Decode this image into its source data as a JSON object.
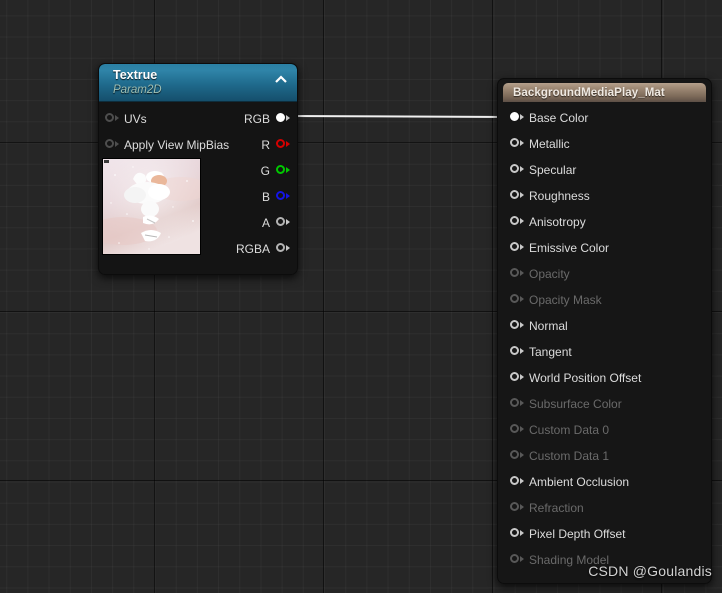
{
  "app": {
    "editor": "Material Graph",
    "watermark": "CSDN @Goulandis"
  },
  "canvas": {
    "background_color": "#262626",
    "grid_minor_color": "#2d2d2d",
    "grid_major_color": "#000000"
  },
  "texture_node": {
    "title": "Textrue",
    "subtitle": "Param2D",
    "header_color": "#2a7fa3",
    "collapse_icon": "chevron-up-icon",
    "inputs": [
      {
        "label": "UVs",
        "state": "unconnected",
        "color": "#4e4e4e"
      },
      {
        "label": "Apply View MipBias",
        "state": "unconnected",
        "color": "#4e4e4e"
      }
    ],
    "outputs": [
      {
        "label": "RGB",
        "state": "connected",
        "color": "#ffffff"
      },
      {
        "label": "R",
        "state": "unconnected",
        "color": "#d40000"
      },
      {
        "label": "G",
        "state": "unconnected",
        "color": "#00c800"
      },
      {
        "label": "B",
        "state": "unconnected",
        "color": "#1414e6"
      },
      {
        "label": "A",
        "state": "unconnected",
        "color": "#b4b4b4"
      },
      {
        "label": "RGBA",
        "state": "unconnected",
        "color": "#b4b4b4"
      }
    ],
    "thumbnail": {
      "description": "pink sky with white clouds texture preview"
    }
  },
  "material_node": {
    "title": "BackgroundMediaPlay_Mat",
    "header_color": "#a08b76",
    "inputs": [
      {
        "label": "Base Color",
        "enabled": true,
        "state": "connected"
      },
      {
        "label": "Metallic",
        "enabled": true,
        "state": "unconnected"
      },
      {
        "label": "Specular",
        "enabled": true,
        "state": "unconnected"
      },
      {
        "label": "Roughness",
        "enabled": true,
        "state": "unconnected"
      },
      {
        "label": "Anisotropy",
        "enabled": true,
        "state": "unconnected"
      },
      {
        "label": "Emissive Color",
        "enabled": true,
        "state": "unconnected"
      },
      {
        "label": "Opacity",
        "enabled": false,
        "state": "disabled"
      },
      {
        "label": "Opacity Mask",
        "enabled": false,
        "state": "disabled"
      },
      {
        "label": "Normal",
        "enabled": true,
        "state": "unconnected"
      },
      {
        "label": "Tangent",
        "enabled": true,
        "state": "unconnected"
      },
      {
        "label": "World Position Offset",
        "enabled": true,
        "state": "unconnected"
      },
      {
        "label": "Subsurface Color",
        "enabled": false,
        "state": "disabled"
      },
      {
        "label": "Custom Data 0",
        "enabled": false,
        "state": "disabled"
      },
      {
        "label": "Custom Data 1",
        "enabled": false,
        "state": "disabled"
      },
      {
        "label": "Ambient Occlusion",
        "enabled": true,
        "state": "unconnected"
      },
      {
        "label": "Refraction",
        "enabled": false,
        "state": "disabled"
      },
      {
        "label": "Pixel Depth Offset",
        "enabled": true,
        "state": "unconnected"
      },
      {
        "label": "Shading Model",
        "enabled": false,
        "state": "disabled"
      }
    ]
  },
  "connections": [
    {
      "from": "Textrue.RGB",
      "to": "BackgroundMediaPlay_Mat.Base Color",
      "color": "#ffffff"
    }
  ]
}
